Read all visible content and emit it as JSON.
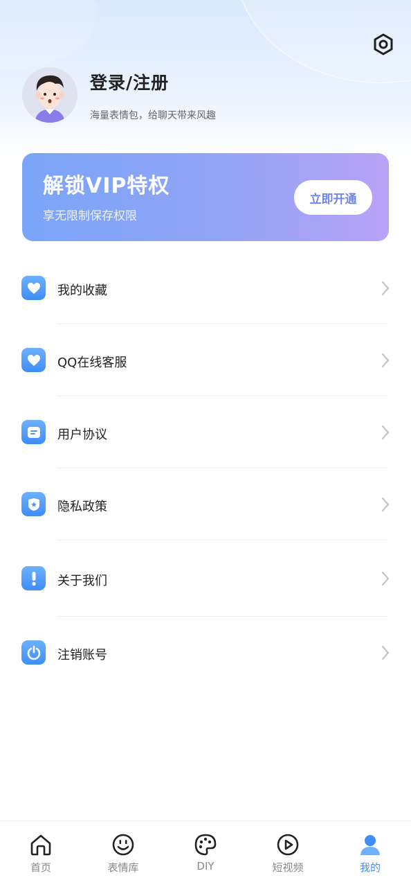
{
  "profile": {
    "login_label": "登录/注册",
    "tagline": "海量表情包，给聊天带来风趣"
  },
  "vip": {
    "title": "解锁VIP特权",
    "subtitle": "享无限制保存权限",
    "button": "立即开通"
  },
  "menu": [
    {
      "label": "我的收藏",
      "icon": "heart-icon"
    },
    {
      "label": "QQ在线客服",
      "icon": "heart-icon"
    },
    {
      "label": "用户协议",
      "icon": "document-icon"
    },
    {
      "label": "隐私政策",
      "icon": "shield-star-icon"
    },
    {
      "label": "关于我们",
      "icon": "exclamation-icon"
    },
    {
      "label": "注销账号",
      "icon": "power-icon"
    }
  ],
  "tabbar": [
    {
      "label": "首页",
      "icon": "home-icon",
      "active": false
    },
    {
      "label": "表情库",
      "icon": "smiley-icon",
      "active": false
    },
    {
      "label": "DIY",
      "icon": "palette-icon",
      "active": false
    },
    {
      "label": "短视频",
      "icon": "play-icon",
      "active": false
    },
    {
      "label": "我的",
      "icon": "user-icon",
      "active": true
    }
  ],
  "colors": {
    "accent": "#3f8ef7",
    "vip_gradient_start": "#7aa5f8",
    "vip_gradient_end": "#b8a2f7",
    "vip_button_text": "#6f86e6"
  }
}
